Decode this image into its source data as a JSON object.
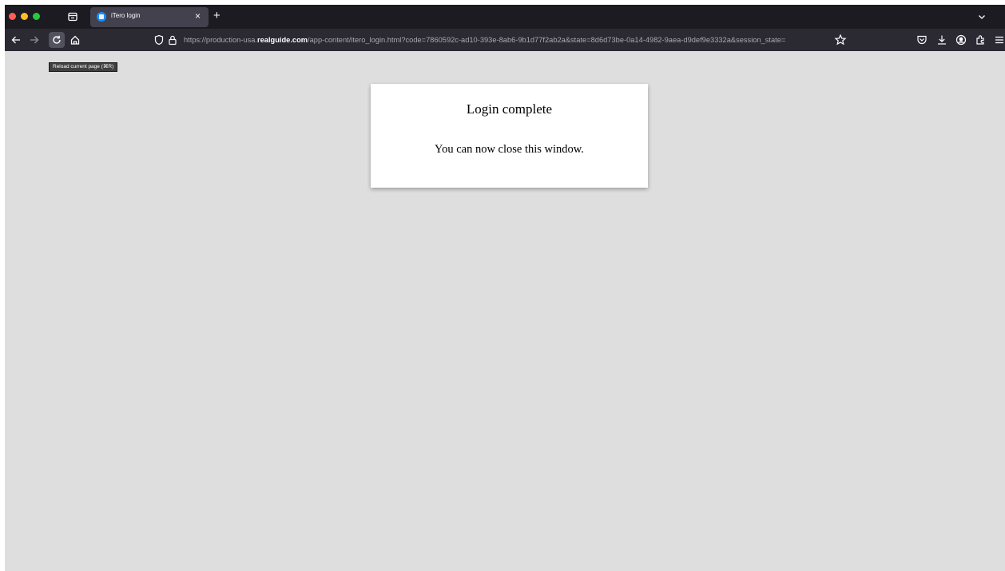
{
  "window": {
    "traffic_lights": [
      "close",
      "minimize",
      "maximize"
    ]
  },
  "tabs": [
    {
      "title": "iTero login",
      "favicon": "itero-favicon-icon",
      "active": true
    }
  ],
  "toolbar": {
    "new_tab_label": "+",
    "tab_close_label": "×"
  },
  "url_bar": {
    "prefix": "https://production-usa.",
    "domain": "realguide.com",
    "path": "/app-content/itero_login.html?code=7860592c-ad10-393e-8ab6-9b1d77f2ab2a&state=8d6d73be-0a14-4982-9aea-d9def9e3332a&session_state=",
    "icons": [
      "shield-icon",
      "lock-icon",
      "star-icon"
    ]
  },
  "tooltip": {
    "text": "Reload current page (⌘R)"
  },
  "page": {
    "background": "#dedede",
    "card": {
      "title": "Login complete",
      "message": "You can now close this window."
    }
  },
  "colors": {
    "tabstrip": "#1c1b22",
    "navbar": "#2b2a33",
    "active_tab": "#42414d",
    "close_light": "#ff5f57",
    "minimize_light": "#febc2e",
    "maximize_light": "#28c840"
  }
}
